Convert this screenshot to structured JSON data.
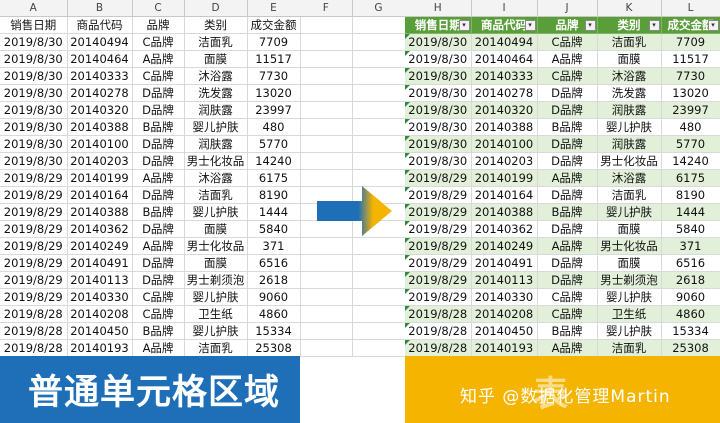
{
  "columns_left": [
    "A",
    "B",
    "C",
    "D",
    "E"
  ],
  "columns_gap": [
    "F",
    "G"
  ],
  "columns_right": [
    "H",
    "I",
    "J",
    "K",
    "L"
  ],
  "headers": [
    "销售日期",
    "商品代码",
    "品牌",
    "类别",
    "成交金额"
  ],
  "right_headers_truncated": [
    "销售日期",
    "商品代码",
    "品牌",
    "类别",
    "成交金额"
  ],
  "rows": [
    [
      "2019/8/30",
      "20140494",
      "C品牌",
      "洁面乳",
      "7709"
    ],
    [
      "2019/8/30",
      "20140464",
      "A品牌",
      "面膜",
      "11517"
    ],
    [
      "2019/8/30",
      "20140333",
      "C品牌",
      "沐浴露",
      "7730"
    ],
    [
      "2019/8/30",
      "20140278",
      "D品牌",
      "洗发露",
      "13020"
    ],
    [
      "2019/8/30",
      "20140320",
      "D品牌",
      "润肤露",
      "23997"
    ],
    [
      "2019/8/30",
      "20140388",
      "B品牌",
      "婴儿护肤",
      "480"
    ],
    [
      "2019/8/30",
      "20140100",
      "D品牌",
      "润肤露",
      "5770"
    ],
    [
      "2019/8/30",
      "20140203",
      "D品牌",
      "男士化妆品",
      "14240"
    ],
    [
      "2019/8/29",
      "20140199",
      "A品牌",
      "沐浴露",
      "6175"
    ],
    [
      "2019/8/29",
      "20140164",
      "D品牌",
      "洁面乳",
      "8190"
    ],
    [
      "2019/8/29",
      "20140388",
      "B品牌",
      "婴儿护肤",
      "1444"
    ],
    [
      "2019/8/29",
      "20140362",
      "D品牌",
      "面膜",
      "5840"
    ],
    [
      "2019/8/29",
      "20140249",
      "A品牌",
      "男士化妆品",
      "371"
    ],
    [
      "2019/8/29",
      "20140491",
      "D品牌",
      "面膜",
      "6516"
    ],
    [
      "2019/8/29",
      "20140113",
      "D品牌",
      "男士剃须泡",
      "2618"
    ],
    [
      "2019/8/29",
      "20140330",
      "C品牌",
      "婴儿护肤",
      "9060"
    ],
    [
      "2019/8/28",
      "20140208",
      "C品牌",
      "卫生纸",
      "4860"
    ],
    [
      "2019/8/28",
      "20140450",
      "B品牌",
      "婴儿护肤",
      "15334"
    ],
    [
      "2019/8/28",
      "20140193",
      "A品牌",
      "洁面乳",
      "25308"
    ]
  ],
  "banner_left": "普通单元格区域",
  "banner_right": "表",
  "watermark": "知乎 @数据化管理Martin",
  "colors": {
    "table_header_green": "#5a9e3a",
    "band_green": "#e2efd9",
    "banner_blue": "#1e6fb8",
    "banner_yellow": "#f5b400",
    "arrow_from": "#1e6fb8",
    "arrow_to": "#f5b400"
  },
  "icons": {
    "dropdown": "filter-dropdown-icon",
    "arrow": "right-arrow-icon"
  }
}
